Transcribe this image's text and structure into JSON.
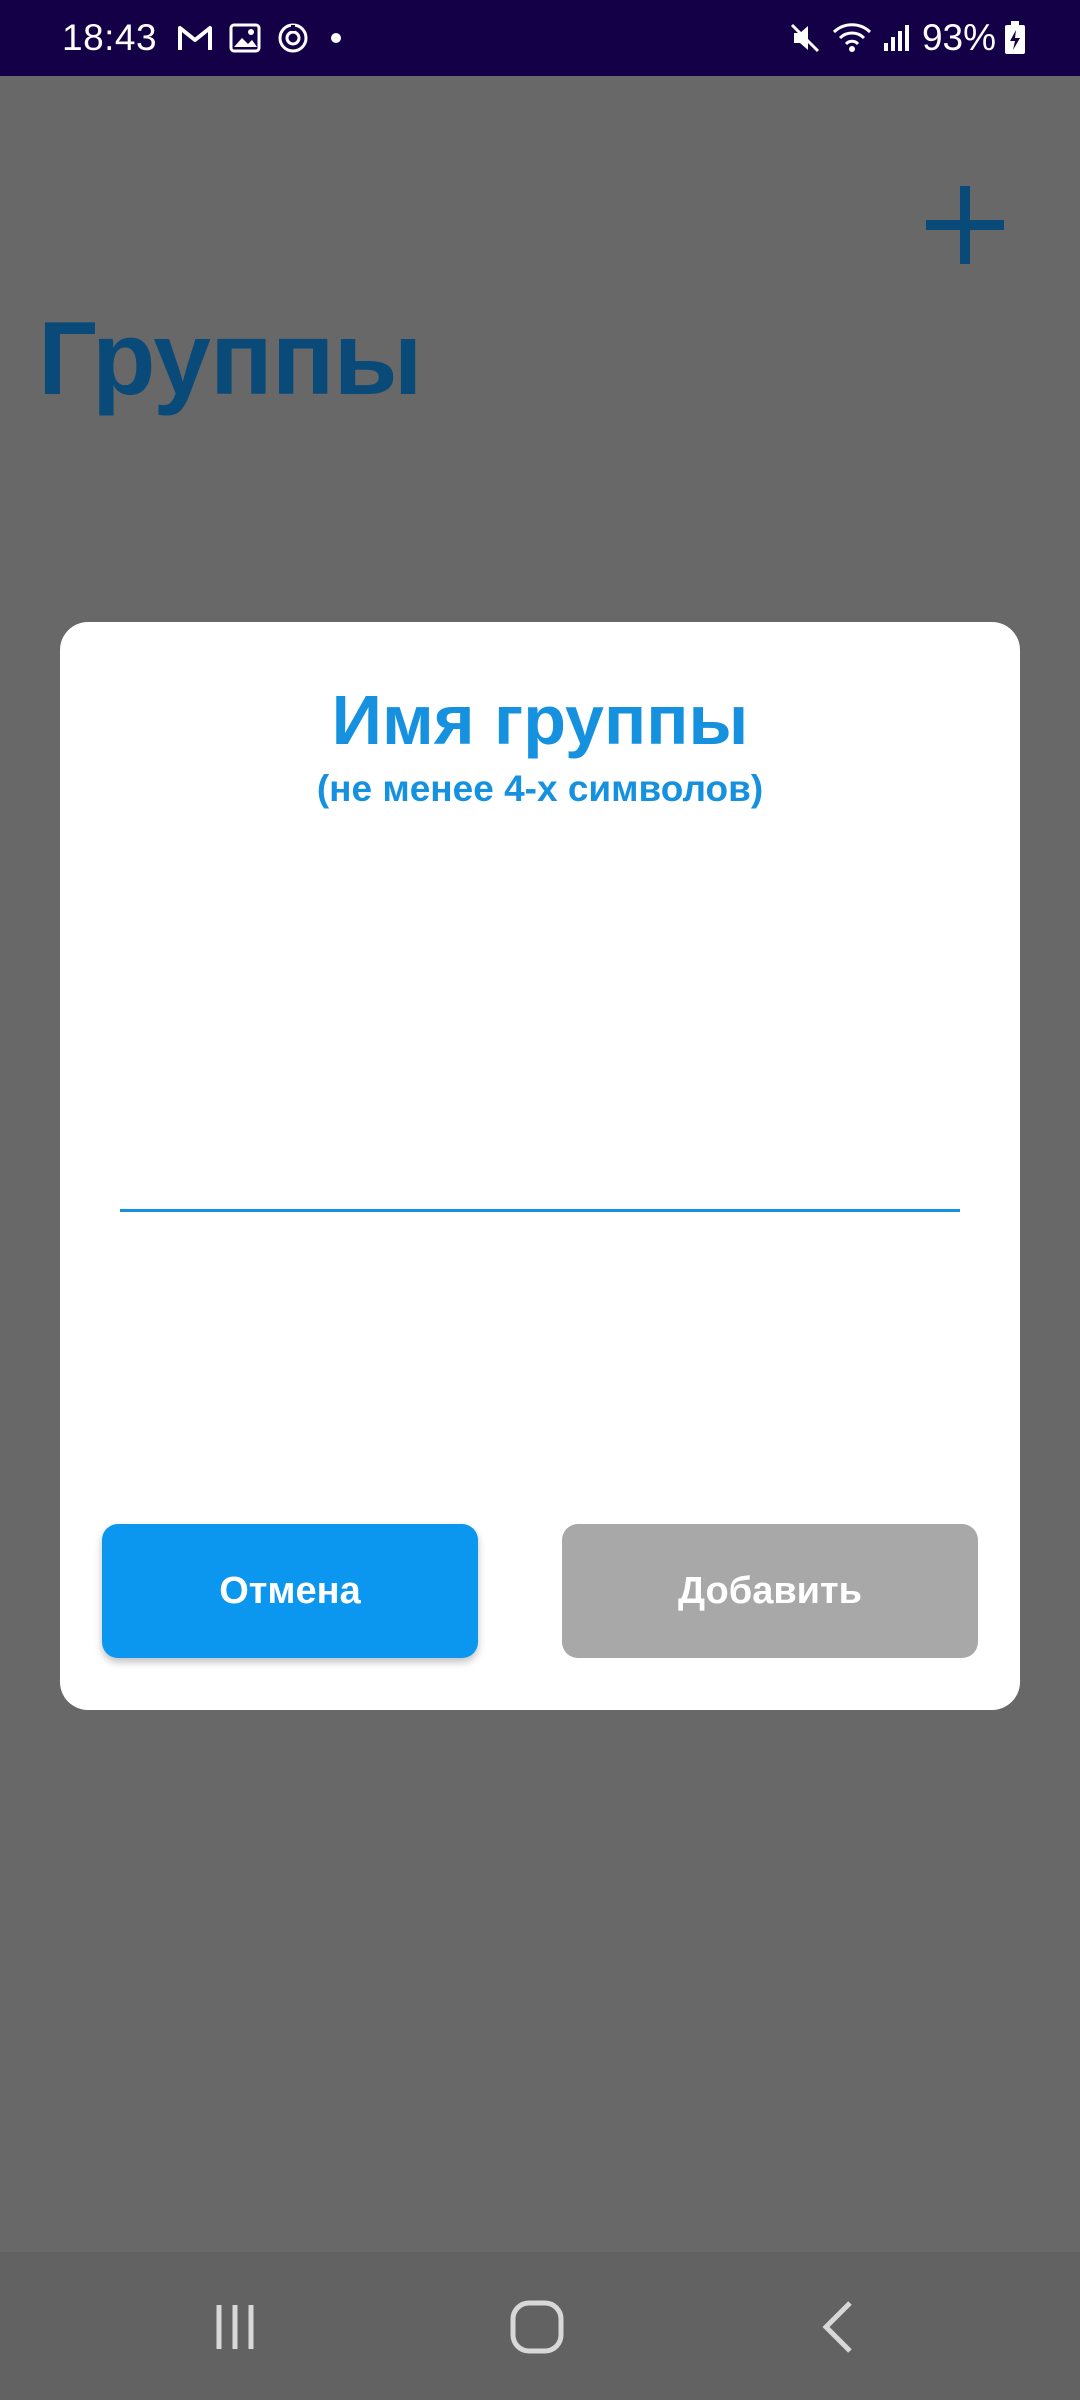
{
  "status_bar": {
    "time": "18:43",
    "battery": "93%",
    "left_icons": [
      "gmail-icon",
      "gallery-icon",
      "sync-icon",
      "notification-dot"
    ],
    "right_icons": [
      "mute-icon",
      "wifi-icon",
      "signal-icon",
      "battery-charging-icon"
    ]
  },
  "page": {
    "title": "Группы",
    "add_icon": "plus-icon",
    "accent_color": "#0a4a78"
  },
  "dialog": {
    "title": "Имя группы",
    "subtitle": "(не менее 4-х символов)",
    "input_value": "",
    "input_placeholder": "",
    "cancel_label": "Отмена",
    "add_label": "Добавить",
    "title_color": "#1591e0",
    "cancel_color": "#0b96ef",
    "add_color_disabled": "#a8a8a8"
  },
  "nav_bar": {
    "buttons": [
      "recent-apps-icon",
      "home-icon",
      "back-icon"
    ]
  }
}
